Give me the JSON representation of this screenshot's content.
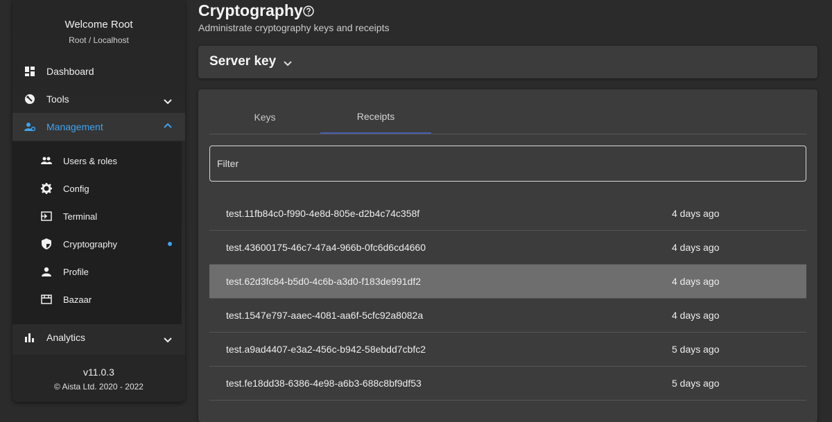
{
  "sidebar": {
    "welcome": "Welcome Root",
    "host": "Root / Localhost",
    "items": [
      {
        "label": "Dashboard",
        "icon": "dashboard-icon"
      },
      {
        "label": "Tools",
        "icon": "tools-icon"
      },
      {
        "label": "Management",
        "icon": "management-icon"
      },
      {
        "label": "Analytics",
        "icon": "analytics-icon"
      }
    ],
    "submenu": [
      {
        "label": "Users & roles",
        "icon": "users-icon"
      },
      {
        "label": "Config",
        "icon": "gear-icon"
      },
      {
        "label": "Terminal",
        "icon": "terminal-icon"
      },
      {
        "label": "Cryptography",
        "icon": "shield-icon"
      },
      {
        "label": "Profile",
        "icon": "person-icon"
      },
      {
        "label": "Bazaar",
        "icon": "store-icon"
      }
    ],
    "version": "v11.0.3",
    "copyright": "© Aista Ltd. 2020 - 2022",
    "accent_color": "#3ea3ef"
  },
  "main": {
    "title": "Cryptography",
    "subtitle": "Administrate cryptography keys and receipts",
    "server_key_label": "Server key",
    "tabs": [
      {
        "label": "Keys"
      },
      {
        "label": "Receipts"
      }
    ],
    "active_tab": "Receipts",
    "filter_placeholder": "Filter",
    "receipts": [
      {
        "name": "test.11fb84c0-f990-4e8d-805e-d2b4c74c358f",
        "time": "4 days ago"
      },
      {
        "name": "test.43600175-46c7-47a4-966b-0fc6d6cd4660",
        "time": "4 days ago"
      },
      {
        "name": "test.62d3fc84-b5d0-4c6b-a3d0-f183de991df2",
        "time": "4 days ago"
      },
      {
        "name": "test.1547e797-aaec-4081-aa6f-5cfc92a8082a",
        "time": "4 days ago"
      },
      {
        "name": "test.a9ad4407-e3a2-456c-b942-58ebdd7cbfc2",
        "time": "5 days ago"
      },
      {
        "name": "test.fe18dd38-6386-4e98-a6b3-688c8bf9df53",
        "time": "5 days ago"
      }
    ]
  }
}
